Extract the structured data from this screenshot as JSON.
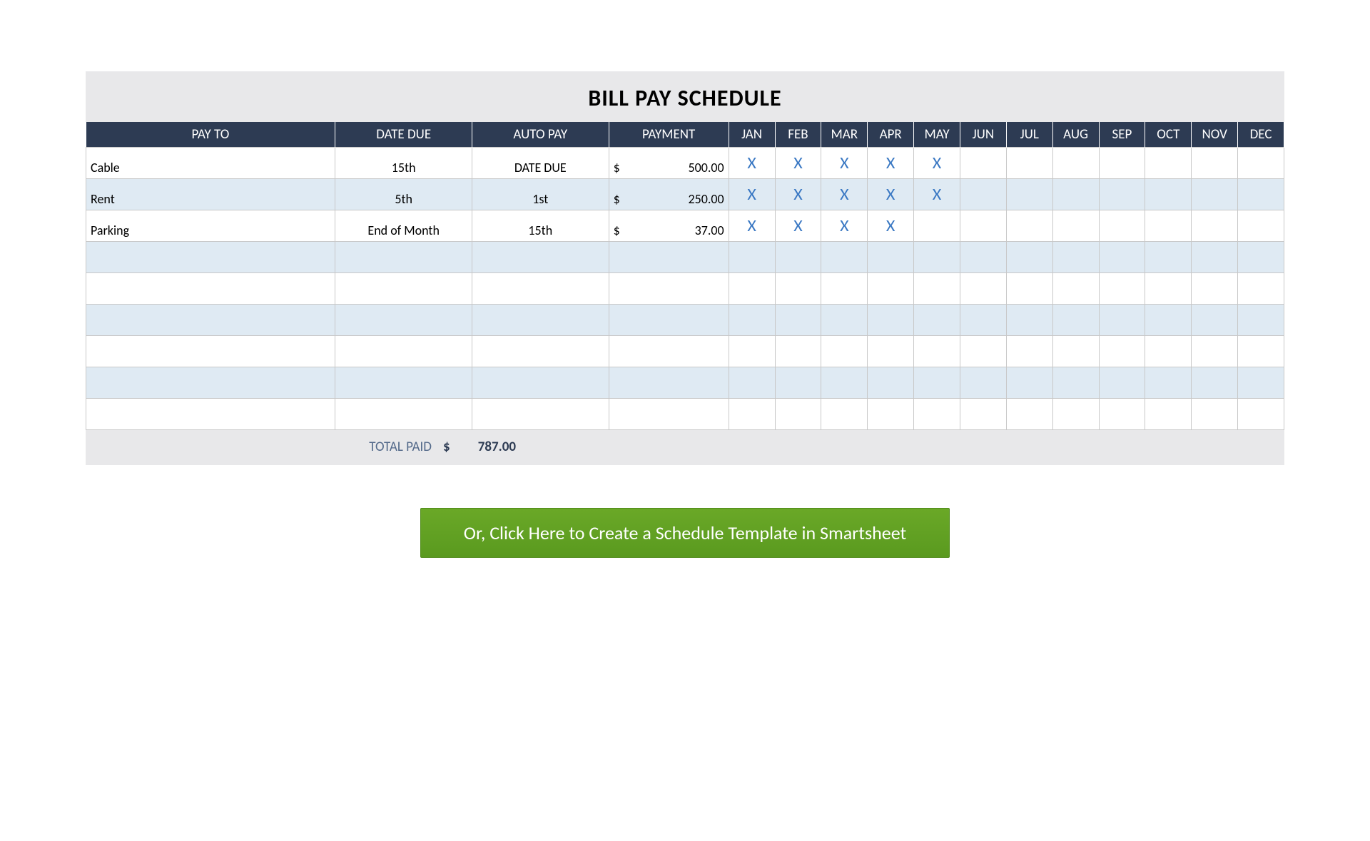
{
  "title": "BILL PAY SCHEDULE",
  "headers": {
    "payto": "PAY TO",
    "datedue": "DATE DUE",
    "autopay": "AUTO PAY",
    "payment": "PAYMENT"
  },
  "months": [
    "JAN",
    "FEB",
    "MAR",
    "APR",
    "MAY",
    "JUN",
    "JUL",
    "AUG",
    "SEP",
    "OCT",
    "NOV",
    "DEC"
  ],
  "currency": "$",
  "check_glyph": "X",
  "rows": [
    {
      "payto": "Cable",
      "datedue": "15th",
      "autopay": "DATE DUE",
      "payment": "500.00",
      "marks": [
        true,
        true,
        true,
        true,
        true,
        false,
        false,
        false,
        false,
        false,
        false,
        false
      ]
    },
    {
      "payto": "Rent",
      "datedue": "5th",
      "autopay": "1st",
      "payment": "250.00",
      "marks": [
        true,
        true,
        true,
        true,
        true,
        false,
        false,
        false,
        false,
        false,
        false,
        false
      ]
    },
    {
      "payto": "Parking",
      "datedue": "End of Month",
      "autopay": "15th",
      "payment": "37.00",
      "marks": [
        true,
        true,
        true,
        true,
        false,
        false,
        false,
        false,
        false,
        false,
        false,
        false
      ]
    },
    {
      "payto": "",
      "datedue": "",
      "autopay": "",
      "payment": "",
      "marks": [
        false,
        false,
        false,
        false,
        false,
        false,
        false,
        false,
        false,
        false,
        false,
        false
      ]
    },
    {
      "payto": "",
      "datedue": "",
      "autopay": "",
      "payment": "",
      "marks": [
        false,
        false,
        false,
        false,
        false,
        false,
        false,
        false,
        false,
        false,
        false,
        false
      ]
    },
    {
      "payto": "",
      "datedue": "",
      "autopay": "",
      "payment": "",
      "marks": [
        false,
        false,
        false,
        false,
        false,
        false,
        false,
        false,
        false,
        false,
        false,
        false
      ]
    },
    {
      "payto": "",
      "datedue": "",
      "autopay": "",
      "payment": "",
      "marks": [
        false,
        false,
        false,
        false,
        false,
        false,
        false,
        false,
        false,
        false,
        false,
        false
      ]
    },
    {
      "payto": "",
      "datedue": "",
      "autopay": "",
      "payment": "",
      "marks": [
        false,
        false,
        false,
        false,
        false,
        false,
        false,
        false,
        false,
        false,
        false,
        false
      ]
    },
    {
      "payto": "",
      "datedue": "",
      "autopay": "",
      "payment": "",
      "marks": [
        false,
        false,
        false,
        false,
        false,
        false,
        false,
        false,
        false,
        false,
        false,
        false
      ]
    }
  ],
  "total": {
    "label": "TOTAL PAID",
    "value": "787.00"
  },
  "cta": "Or, Click Here to Create a Schedule Template in Smartsheet"
}
